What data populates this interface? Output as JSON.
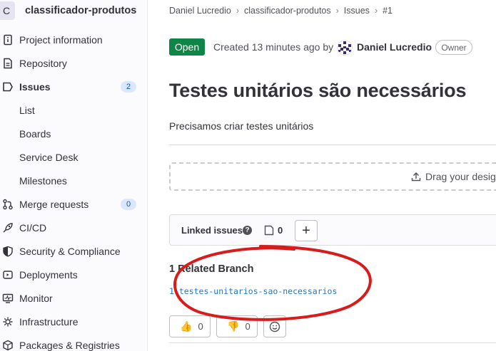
{
  "sidebar": {
    "project_initial": "C",
    "project_name": "classificador-produtos",
    "items": [
      {
        "label": "Project information",
        "icon": "info-doc-icon"
      },
      {
        "label": "Repository",
        "icon": "doc-text-icon"
      },
      {
        "label": "Issues",
        "icon": "issues-icon",
        "count": "2",
        "active": true
      },
      {
        "label": "List"
      },
      {
        "label": "Boards"
      },
      {
        "label": "Service Desk"
      },
      {
        "label": "Milestones"
      },
      {
        "label": "Merge requests",
        "icon": "merge-request-icon",
        "count": "0"
      },
      {
        "label": "CI/CD",
        "icon": "rocket-icon"
      },
      {
        "label": "Security & Compliance",
        "icon": "shield-icon"
      },
      {
        "label": "Deployments",
        "icon": "deployments-icon"
      },
      {
        "label": "Monitor",
        "icon": "monitor-icon"
      },
      {
        "label": "Infrastructure",
        "icon": "cloud-gear-icon"
      },
      {
        "label": "Packages & Registries",
        "icon": "package-icon"
      }
    ]
  },
  "breadcrumb": [
    "Daniel Lucredio",
    "classificador-produtos",
    "Issues",
    "#1"
  ],
  "issue": {
    "status": "Open",
    "created_text": "Created 13 minutes ago by",
    "author": "Daniel Lucredio",
    "role_badge": "Owner",
    "title": "Testes unitários são necessários",
    "description": "Precisamos criar testes unitários"
  },
  "dropzone": {
    "text": "Drag your desig"
  },
  "linked_issues": {
    "label": "Linked issues",
    "count": "0",
    "add_label": "+"
  },
  "related_branch": {
    "heading": "1 Related Branch",
    "branch": "1-testes-unitarios-sao-necessarios"
  },
  "reactions": [
    {
      "emoji": "👍",
      "count": "0",
      "icon": "thumbs-up-icon"
    },
    {
      "emoji": "👎",
      "count": "0",
      "icon": "thumbs-down-icon"
    }
  ],
  "colors": {
    "open_status": "#108548",
    "link": "#1f75cb",
    "annotation": "#d81b1b",
    "badge_bg": "#dbe7fe"
  }
}
